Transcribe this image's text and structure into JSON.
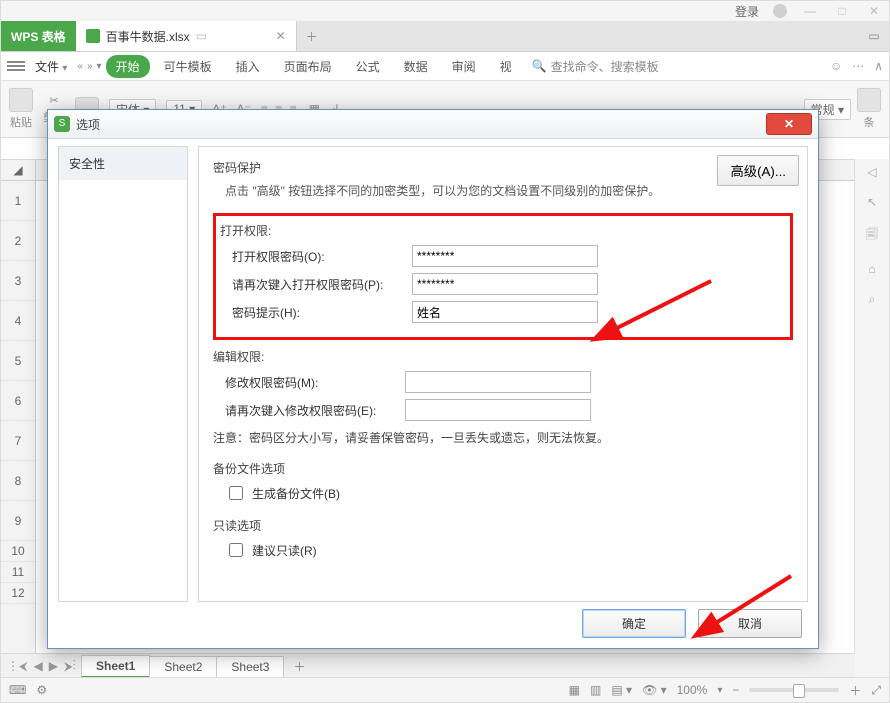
{
  "titlebar": {
    "login": "登录"
  },
  "tabs": {
    "app": "WPS 表格",
    "file": "百事牛数据.xlsx"
  },
  "menu": {
    "file": "文件",
    "items": [
      "开始",
      "可牛模板",
      "插入",
      "页面布局",
      "公式",
      "数据",
      "审阅",
      "视"
    ],
    "search_placeholder": "查找命令、搜索模板"
  },
  "ribbon": {
    "paste": "粘贴",
    "cut": "剪切",
    "font": "宋体",
    "size": "11",
    "numfmt": "常规",
    "cond": "条"
  },
  "rowheads": [
    "1",
    "2",
    "3",
    "4",
    "5",
    "6",
    "7",
    "8",
    "9",
    "10",
    "11",
    "12"
  ],
  "sheettabs": {
    "tabs": [
      "Sheet1",
      "Sheet2",
      "Sheet3"
    ]
  },
  "status": {
    "zoom": "100%"
  },
  "dialog": {
    "title": "选项",
    "left_item": "安全性",
    "sect_password": "密码保护",
    "hint": "点击 \"高级\" 按钮选择不同的加密类型，可以为您的文档设置不同级别的加密保护。",
    "advanced": "高级(A)...",
    "open_perm_head": "打开权限:",
    "open_pwd_label": "打开权限密码(O):",
    "open_pwd_value": "********",
    "open_pwd2_label": "请再次键入打开权限密码(P):",
    "open_pwd2_value": "********",
    "hint_label": "密码提示(H):",
    "hint_value": "姓名",
    "edit_perm_head": "编辑权限:",
    "edit_pwd_label": "修改权限密码(M):",
    "edit_pwd_value": "",
    "edit_pwd2_label": "请再次键入修改权限密码(E):",
    "edit_pwd2_value": "",
    "note": "注意：密码区分大小写，请妥善保管密码，一旦丢失或遗忘，则无法恢复。",
    "backup_head": "备份文件选项",
    "backup_chk": "生成备份文件(B)",
    "readonly_head": "只读选项",
    "readonly_chk": "建议只读(R)",
    "ok": "确定",
    "cancel": "取消"
  }
}
